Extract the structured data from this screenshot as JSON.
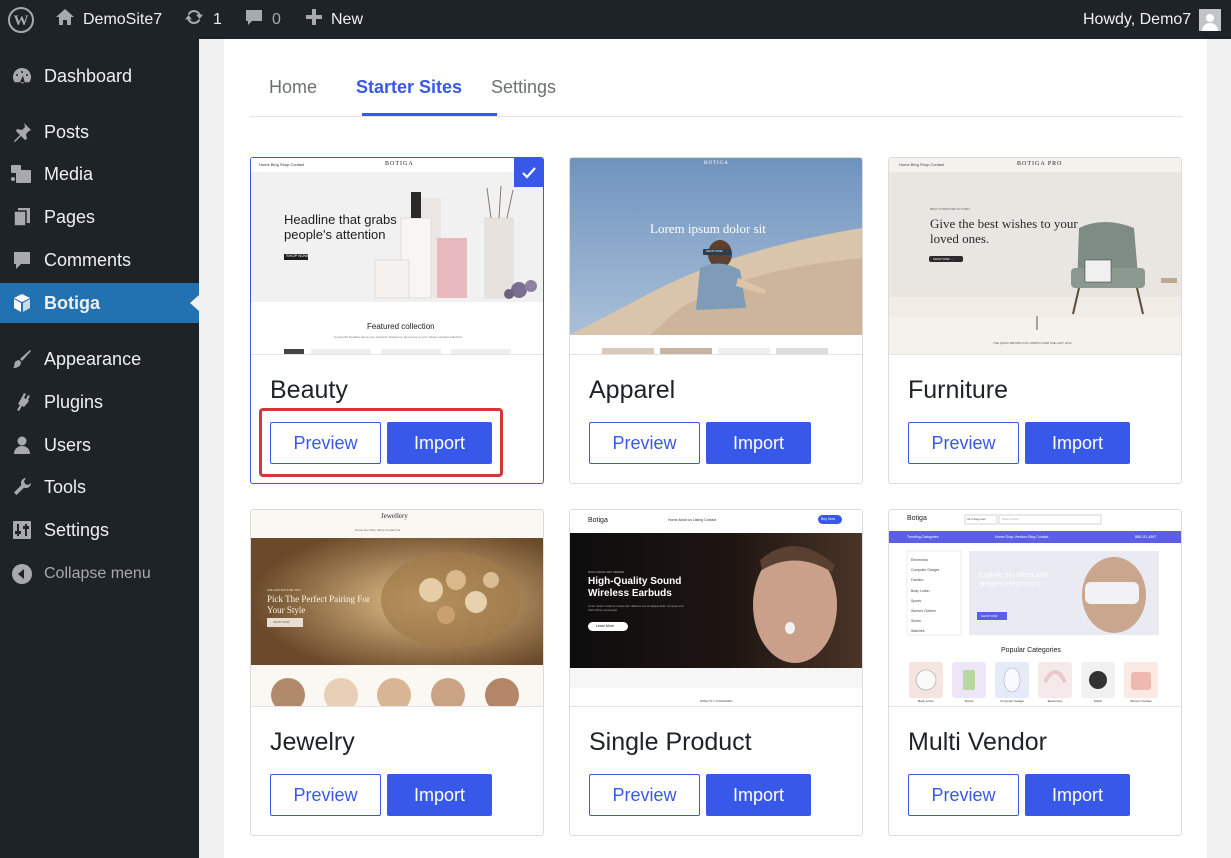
{
  "adminbar": {
    "site_name": "DemoSite7",
    "updates_count": "1",
    "comments_count": "0",
    "new_label": "New",
    "greeting": "Howdy, Demo7"
  },
  "sidebar": {
    "items": [
      {
        "label": "Dashboard",
        "icon": "dashboard-icon"
      },
      {
        "label": "Posts",
        "icon": "pin-icon"
      },
      {
        "label": "Media",
        "icon": "media-icon"
      },
      {
        "label": "Pages",
        "icon": "pages-icon"
      },
      {
        "label": "Comments",
        "icon": "comment-icon"
      },
      {
        "label": "Botiga",
        "icon": "cube-icon"
      },
      {
        "label": "Appearance",
        "icon": "paintbrush-icon"
      },
      {
        "label": "Plugins",
        "icon": "plug-icon"
      },
      {
        "label": "Users",
        "icon": "user-icon"
      },
      {
        "label": "Tools",
        "icon": "wrench-icon"
      },
      {
        "label": "Settings",
        "icon": "sliders-icon"
      }
    ],
    "collapse_label": "Collapse menu"
  },
  "tabs": [
    {
      "label": "Home",
      "active": false
    },
    {
      "label": "Starter Sites",
      "active": true
    },
    {
      "label": "Settings",
      "active": false
    }
  ],
  "buttons": {
    "preview": "Preview",
    "import": "Import"
  },
  "sites": [
    {
      "name": "Beauty",
      "selected": true,
      "thumb": {
        "brand": "BOTIGA",
        "nav": "Home   Blog   Shop   Contact",
        "headline": "Headline that grabs people's attention",
        "button": "SHOP NOW",
        "section": "Featured collection",
        "section_sub": "A powerful headline about your product's features to give focus to your chosen product collection"
      }
    },
    {
      "name": "Apparel",
      "selected": false,
      "thumb": {
        "brand": "BOTIGA",
        "headline": "Lorem ipsum dolor sit",
        "button": "SHOP NOW"
      }
    },
    {
      "name": "Furniture",
      "selected": false,
      "thumb": {
        "brand": "BOTIGA PRO",
        "nav": "Home   Blog   Shop   Contact",
        "eyebrow": "BEST FURNITURE IN TOWN",
        "headline": "Give the best wishes to your loved ones.",
        "button": "SHOP NOW →",
        "caption": "THE QUICK BROWN FOX JUMPS OVER THE LAZY DOG"
      }
    },
    {
      "name": "Jewelry",
      "selected": false,
      "thumb": {
        "brand": "Jewellery",
        "nav": "Home   Our Story   Shop   Contact Us",
        "eyebrow": "COLLECTION FOR YOU",
        "headline": "Pick The Perfect Pairing For Your Style",
        "button": "SHOP NOW"
      }
    },
    {
      "name": "Single Product",
      "selected": false,
      "thumb": {
        "brand": "Botiga",
        "nav": "Home   About us   Listing   Contact",
        "cta": "Buy Now",
        "eyebrow": "EXCLUSIVE GIFT SERIES",
        "headline": "High-Quality Sound Wireless Earbuds",
        "body": "Amet minim mollit non deserunt ullamco est sit aliqua dolor do amet sint. Velit officia consequat.",
        "button": "Learn More",
        "caption": "DIRECTLY ANSWERED"
      }
    },
    {
      "name": "Multi Vendor",
      "selected": false,
      "thumb": {
        "brand": "Botiga",
        "select": "All Categories",
        "search": "Search store",
        "trending": "Trending Categories",
        "nav": "Home   Shop   Vendors   Blog   Contact",
        "phone": "888-111-4567",
        "categories": [
          "Electronics",
          "Computer Gadget",
          "Fashion",
          "Body Lotion",
          "Sports",
          "Women Clothes",
          "Shoes",
          "Watches"
        ],
        "headline": "Explore our latest and greatest electronics",
        "button": "SHOP NOW",
        "section": "Popular Categories",
        "category_labels": [
          "Body Lotion",
          "Sports",
          "Computer Gadget",
          "Electronics",
          "Watch",
          "Women Clothes"
        ]
      }
    }
  ],
  "colors": {
    "accent": "#3858e9",
    "admin_bar": "#1d2327",
    "active_menu": "#2271b1",
    "highlight": "#d63638"
  }
}
